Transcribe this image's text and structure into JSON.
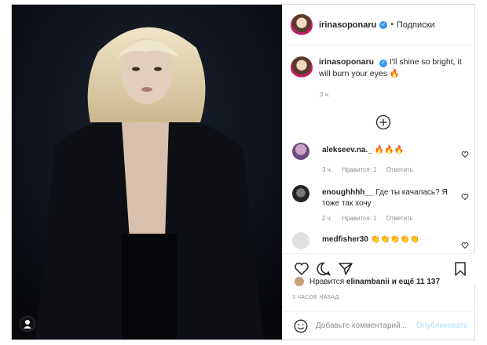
{
  "post": {
    "username": "irinasoponaru",
    "follow_label": "Подписки",
    "caption_user": "irinasoponaru",
    "caption_text": "I'll shine so bright, it will burn your eyes 🔥",
    "caption_time": "3 ч."
  },
  "comments": [
    {
      "user": "alekseev.na._",
      "text": "🔥🔥🔥",
      "time": "3 ч.",
      "likes": "Нравится: 1",
      "reply": "Ответить"
    },
    {
      "user": "enoughhhh__",
      "text": "Где ты качалась? Я тоже так хочу",
      "time": "2 ч.",
      "likes": "Нравится: 1",
      "reply": "Ответить"
    },
    {
      "user": "medfisher30",
      "text": "👏👏👏👏👏"
    }
  ],
  "likes": {
    "prefix": "Нравится",
    "user": "elinambanii",
    "suffix": "и ещё 11 137"
  },
  "timestamp": "3 ЧАСОВ НАЗАД",
  "add_comment": {
    "placeholder": "Добавьте комментарий...",
    "publish_label": "Опубликовать"
  }
}
